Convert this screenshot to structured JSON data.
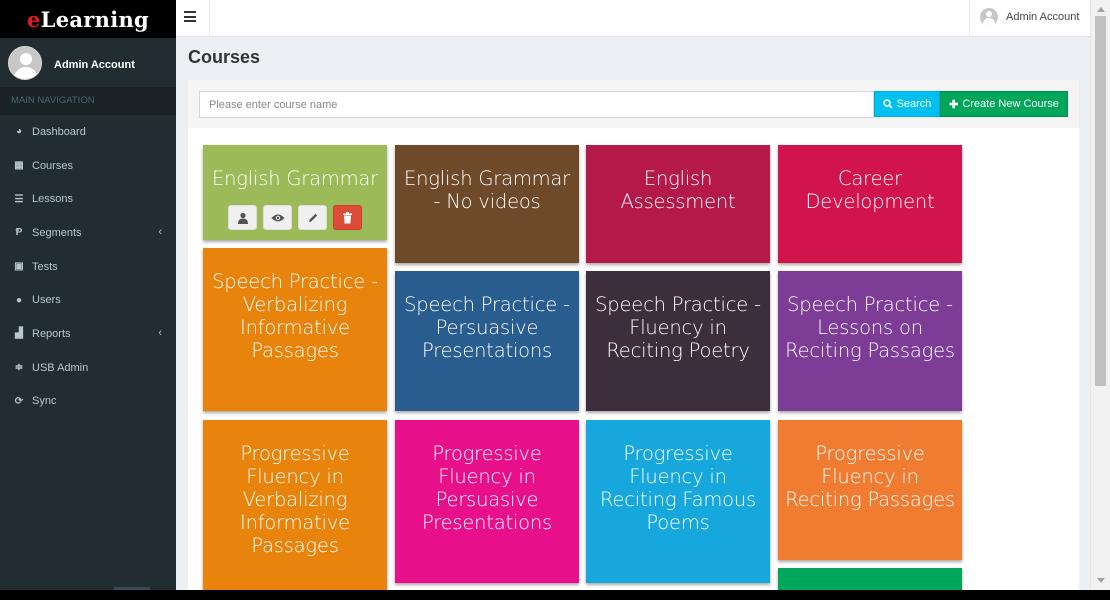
{
  "app": {
    "logo_e": "e",
    "logo_rest": "Learning"
  },
  "sidebar": {
    "user_name": "Admin Account",
    "nav_header": "MAIN NAVIGATION",
    "items": [
      {
        "label": "Dashboard",
        "icon": "dashboard-icon",
        "glyph": "◕",
        "chevron": false
      },
      {
        "label": "Courses",
        "icon": "grid-icon",
        "glyph": "▦",
        "chevron": false
      },
      {
        "label": "Lessons",
        "icon": "list-icon",
        "glyph": "☰",
        "chevron": false
      },
      {
        "label": "Segments",
        "icon": "segments-icon",
        "glyph": "Ᵽ",
        "chevron": true
      },
      {
        "label": "Tests",
        "icon": "tests-icon",
        "glyph": "▣",
        "chevron": false
      },
      {
        "label": "Users",
        "icon": "user-icon",
        "glyph": "●",
        "chevron": false
      },
      {
        "label": "Reports",
        "icon": "bar-chart-icon",
        "glyph": "▟",
        "chevron": true
      },
      {
        "label": "USB Admin",
        "icon": "sliders-icon",
        "glyph": "≑",
        "chevron": false
      },
      {
        "label": "Sync",
        "icon": "refresh-icon",
        "glyph": "⟳",
        "chevron": false
      }
    ]
  },
  "header": {
    "user_name": "Admin Account"
  },
  "main": {
    "title": "Courses",
    "search_placeholder": "Please enter course name",
    "search_label": "Search",
    "create_label": "Create New Course"
  },
  "courses": [
    {
      "title": "English Grammar",
      "color": "#9cbb58",
      "has_actions": true
    },
    {
      "title": "English Grammar - No videos",
      "color": "#6e4a2a"
    },
    {
      "title": "English Assessment",
      "color": "#b5194a"
    },
    {
      "title": "Career Development",
      "color": "#d1144c"
    },
    {
      "title": "Speech Practice - Verbalizing Informative Passages",
      "color": "#e8830b"
    },
    {
      "title": "Speech Practice - Persuasive Presentations",
      "color": "#2a5d8f"
    },
    {
      "title": "Speech Practice - Fluency in Reciting Poetry",
      "color": "#3c2f3b"
    },
    {
      "title": "Speech Practice - Lessons on Reciting Passages",
      "color": "#7d3d96"
    },
    {
      "title": "Progressive Fluency in Verbalizing Informative Passages",
      "color": "#e8830b"
    },
    {
      "title": "Progressive Fluency in Persuasive Presentations",
      "color": "#e80f8a"
    },
    {
      "title": "Progressive Fluency in Reciting Famous Poems",
      "color": "#16a8dc"
    },
    {
      "title": "Progressive Fluency in Reciting Passages",
      "color": "#f07c32"
    },
    {
      "title": "",
      "color": "#00a65a"
    }
  ],
  "colors": {
    "sidebar_bg": "#222d32",
    "search_button": "#00c0ef",
    "create_button": "#00a65a",
    "delete_button": "#dd4b39"
  }
}
